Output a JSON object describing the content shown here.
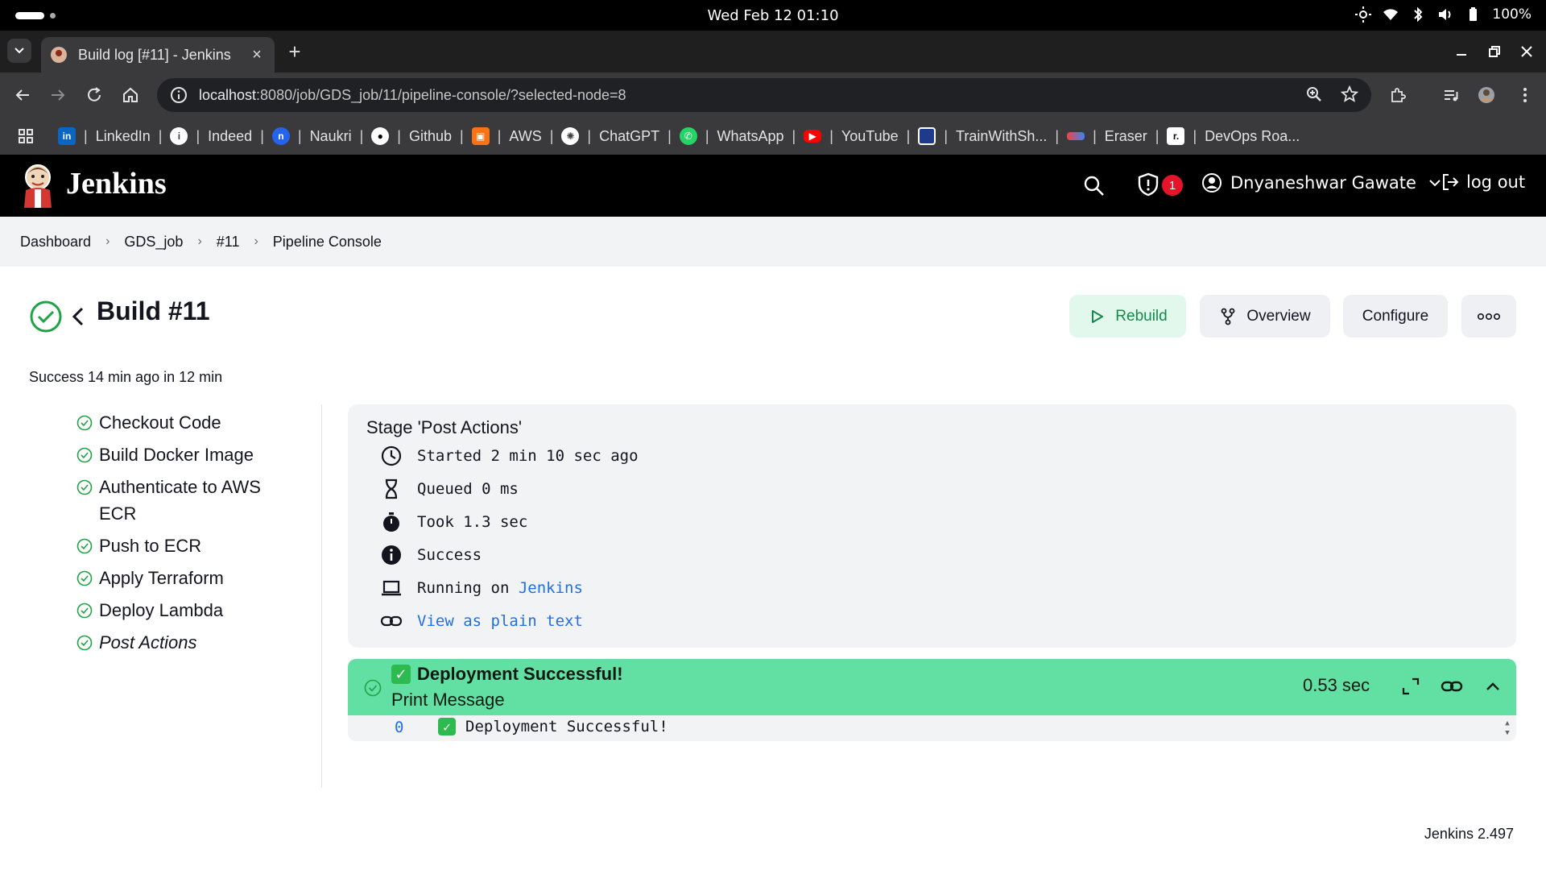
{
  "os": {
    "clock": "Wed Feb 12  01:10",
    "battery": "100%"
  },
  "browser": {
    "tab_title": "Build log [#11] - Jenkins",
    "url_host": "localhost",
    "url_rest": ":8080/job/GDS_job/11/pipeline-console/?selected-node=8",
    "bookmarks": [
      {
        "label": "LinkedIn",
        "icon": "linkedin-icon",
        "color": "#0a66c2"
      },
      {
        "label": "Indeed",
        "icon": "info-icon",
        "color": "#ffffff"
      },
      {
        "label": "Naukri",
        "icon": "naukri-icon",
        "color": "#2563eb"
      },
      {
        "label": "Github",
        "icon": "github-icon",
        "color": "#ffffff"
      },
      {
        "label": "AWS",
        "icon": "aws-icon",
        "color": "#f97316"
      },
      {
        "label": "ChatGPT",
        "icon": "chatgpt-icon",
        "color": "#ffffff"
      },
      {
        "label": "WhatsApp",
        "icon": "whatsapp-icon",
        "color": "#25d366"
      },
      {
        "label": "YouTube",
        "icon": "youtube-icon",
        "color": "#ff0000"
      },
      {
        "label": "TrainWithSh...",
        "icon": "trainwithshubham-icon",
        "color": "#1e3a8a"
      },
      {
        "label": "Eraser",
        "icon": "eraser-icon",
        "color": "#ef4444"
      },
      {
        "label": "DevOps Roa...",
        "icon": "roadmap-icon",
        "color": "#111111"
      }
    ]
  },
  "jenkins": {
    "title": "Jenkins",
    "alert_count": "1",
    "user_name": "Dnyaneshwar Gawate",
    "logout_label": "log out",
    "version": "Jenkins 2.497"
  },
  "breadcrumb": [
    "Dashboard",
    "GDS_job",
    "#11",
    "Pipeline Console"
  ],
  "build": {
    "title": "Build #11",
    "summary": "Success 14 min ago in 12 min",
    "actions": {
      "rebuild": "Rebuild",
      "overview": "Overview",
      "configure": "Configure"
    }
  },
  "stages": [
    {
      "label": "Checkout Code",
      "status": "success"
    },
    {
      "label": "Build Docker Image",
      "status": "success"
    },
    {
      "label": "Authenticate to AWS ECR",
      "status": "success"
    },
    {
      "label": "Push to ECR",
      "status": "success"
    },
    {
      "label": "Apply Terraform",
      "status": "success"
    },
    {
      "label": "Deploy Lambda",
      "status": "success"
    },
    {
      "label": "Post Actions",
      "status": "success",
      "selected": true
    }
  ],
  "stage_details": {
    "title": "Stage 'Post Actions'",
    "started": "Started 2 min 10 sec ago",
    "queued": "Queued 0 ms",
    "took": "Took 1.3 sec",
    "status": "Success",
    "running_prefix": "Running on ",
    "running_node": "Jenkins",
    "plain_text_link": "View as plain text"
  },
  "step": {
    "title": "Deployment Successful!",
    "subtitle": "Print Message",
    "duration": "0.53 sec",
    "color": "#62dfa3"
  },
  "log": {
    "line_number": "0",
    "text": "Deployment Successful!"
  },
  "colors": {
    "success": "#1ea446",
    "link": "#1f6feb",
    "badge": "#e5142b"
  }
}
